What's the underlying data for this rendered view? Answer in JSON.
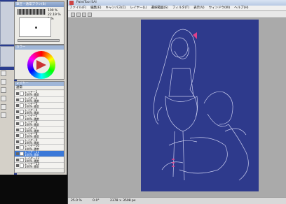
{
  "app": {
    "title": "PaintTool SAI",
    "menu": [
      "ファイル(F)",
      "編集(E)",
      "キャンバス(C)",
      "レイヤー(L)",
      "選択範囲(S)",
      "フィルタ(T)",
      "表示(V)",
      "ウィンドウ(W)",
      "ヘルプ(H)"
    ]
  },
  "brush_panel": {
    "title": "筆圧・通常ブラシ(B)",
    "size_values": [
      "100 %",
      "22.19 %",
      "2 %"
    ]
  },
  "color_panel": {
    "title": "カラー"
  },
  "layer_panel": {
    "title": "レイヤー",
    "mode": "通常",
    "layers": [
      {
        "name": "レイヤー1",
        "opacity": "100% 通常",
        "selected": false
      },
      {
        "name": "レイヤー2",
        "opacity": "100% 通常",
        "selected": false
      },
      {
        "name": "レイヤー3",
        "opacity": "100% 通常",
        "selected": false
      },
      {
        "name": "レイヤー4",
        "opacity": "100% 通常",
        "selected": false
      },
      {
        "name": "レイヤー5",
        "opacity": "100% 通常",
        "selected": false
      },
      {
        "name": "レイヤー6",
        "opacity": "100% 通常",
        "selected": false
      },
      {
        "name": "レイヤー7",
        "opacity": "100% 通常",
        "selected": false
      },
      {
        "name": "レイヤー8",
        "opacity": "100% 通常",
        "selected": false
      },
      {
        "name": "レイヤー9",
        "opacity": "100% 通常",
        "selected": false
      },
      {
        "name": "レイヤー10",
        "opacity": "100% 通常",
        "selected": false
      },
      {
        "name": "レイヤー11",
        "opacity": "100% 通常",
        "selected": true
      },
      {
        "name": "レイヤー12",
        "opacity": "100% 通常",
        "selected": false
      },
      {
        "name": "レイヤー13",
        "opacity": "100% 通常",
        "selected": false
      }
    ]
  },
  "status": {
    "zoom": "25.0 %",
    "rotation": "0.0°",
    "size": "2378 × 3508 px"
  },
  "colors": {
    "canvas_bg": "#2e3a8c",
    "lineart": "#c8ccee",
    "accent_pink": "#e0408a"
  }
}
